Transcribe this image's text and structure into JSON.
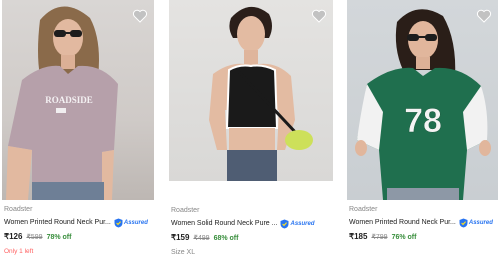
{
  "products": [
    {
      "image_alt": "Roadster lavender printed t-shirt",
      "print_text": "ROADSIDE",
      "brand": "Roadster",
      "title": "Women Printed Round Neck Pur...",
      "assured_label": "Assured",
      "price": "₹126",
      "mrp": "₹599",
      "discount": "78% off",
      "extra": "Only 1 left",
      "extra_type": "stock"
    },
    {
      "image_alt": "Roadster black crop top",
      "brand": "Roadster",
      "title": "Women Solid Round Neck Pure ...",
      "assured_label": "Assured",
      "price": "₹159",
      "mrp": "₹499",
      "discount": "68% off",
      "extra": "Size XL",
      "extra_type": "size"
    },
    {
      "image_alt": "Roadster green 78 sweatshirt-style tee",
      "print_text": "78",
      "brand": "Roadster",
      "title": "Women Printed Round Neck Pur...",
      "assured_label": "Assured",
      "price": "₹185",
      "mrp": "₹799",
      "discount": "76% off",
      "extra": "",
      "extra_type": "none"
    }
  ],
  "colors": {
    "discount": "#388e3c",
    "assured": "#2874f0",
    "stock": "#ff6161",
    "heart": "#c2c2c2"
  },
  "icons": {
    "wishlist": "heart-icon",
    "assured": "assured-badge-icon"
  }
}
